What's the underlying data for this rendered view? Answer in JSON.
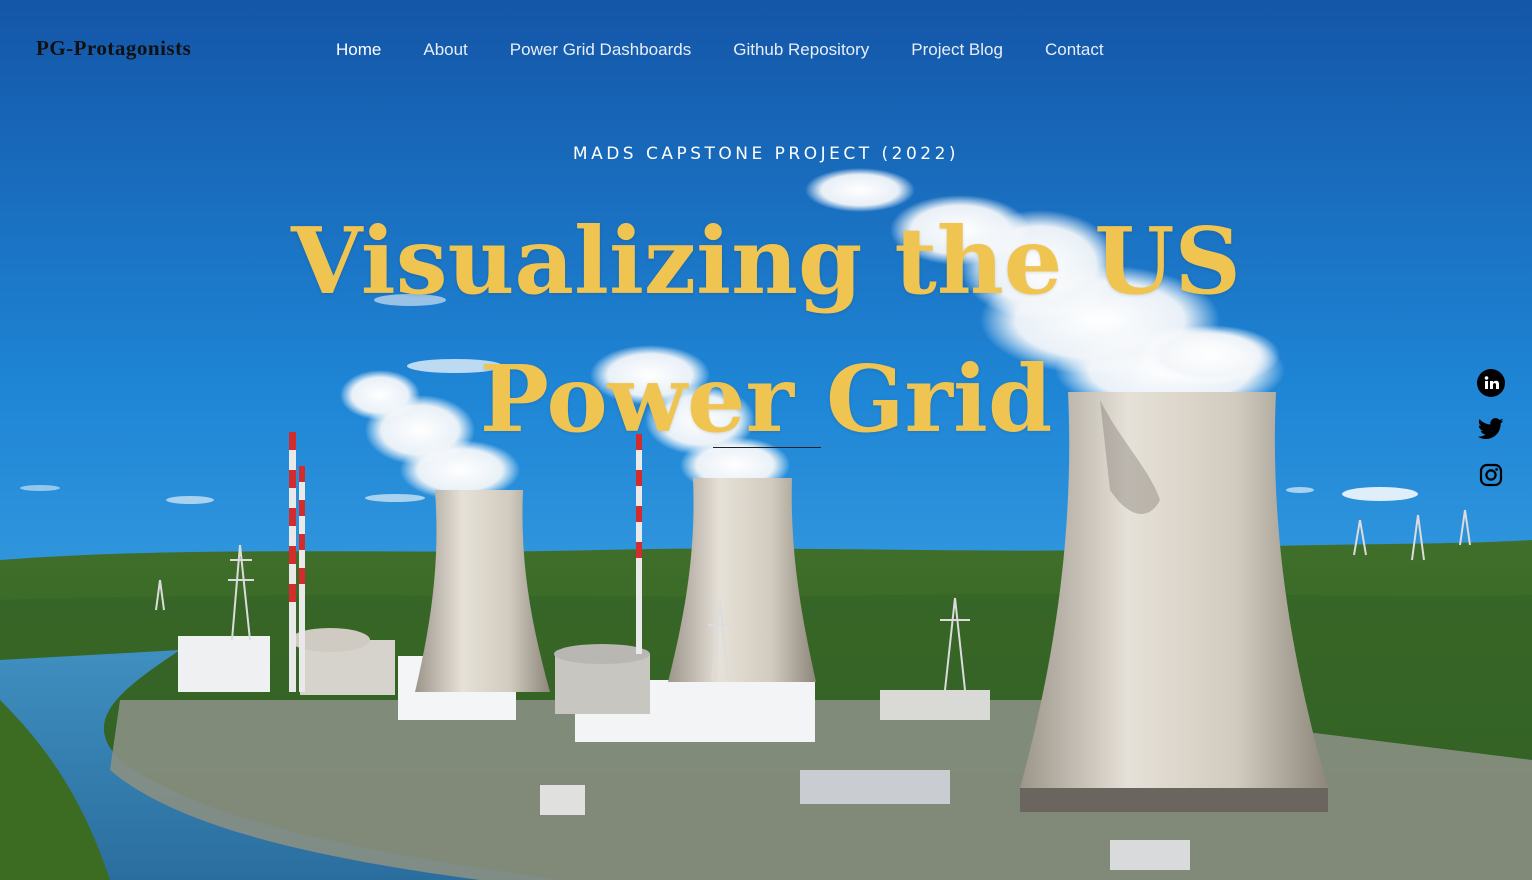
{
  "header": {
    "brand": "PG-Protagonists",
    "nav": [
      {
        "label": "Home",
        "active": true
      },
      {
        "label": "About",
        "active": false
      },
      {
        "label": "Power Grid Dashboards",
        "active": false
      },
      {
        "label": "Github Repository",
        "active": false
      },
      {
        "label": "Project Blog",
        "active": false
      },
      {
        "label": "Contact",
        "active": false
      }
    ]
  },
  "hero": {
    "subtitle": "MADS CAPSTONE PROJECT (2022)",
    "title_line1": "Visualizing the US",
    "title_line2": "Power Grid",
    "background": "Nuclear power plant cooling towers by a river under blue sky",
    "title_color": "#efc451"
  },
  "social": [
    {
      "icon": "linkedin-icon"
    },
    {
      "icon": "twitter-icon"
    },
    {
      "icon": "instagram-icon"
    }
  ]
}
